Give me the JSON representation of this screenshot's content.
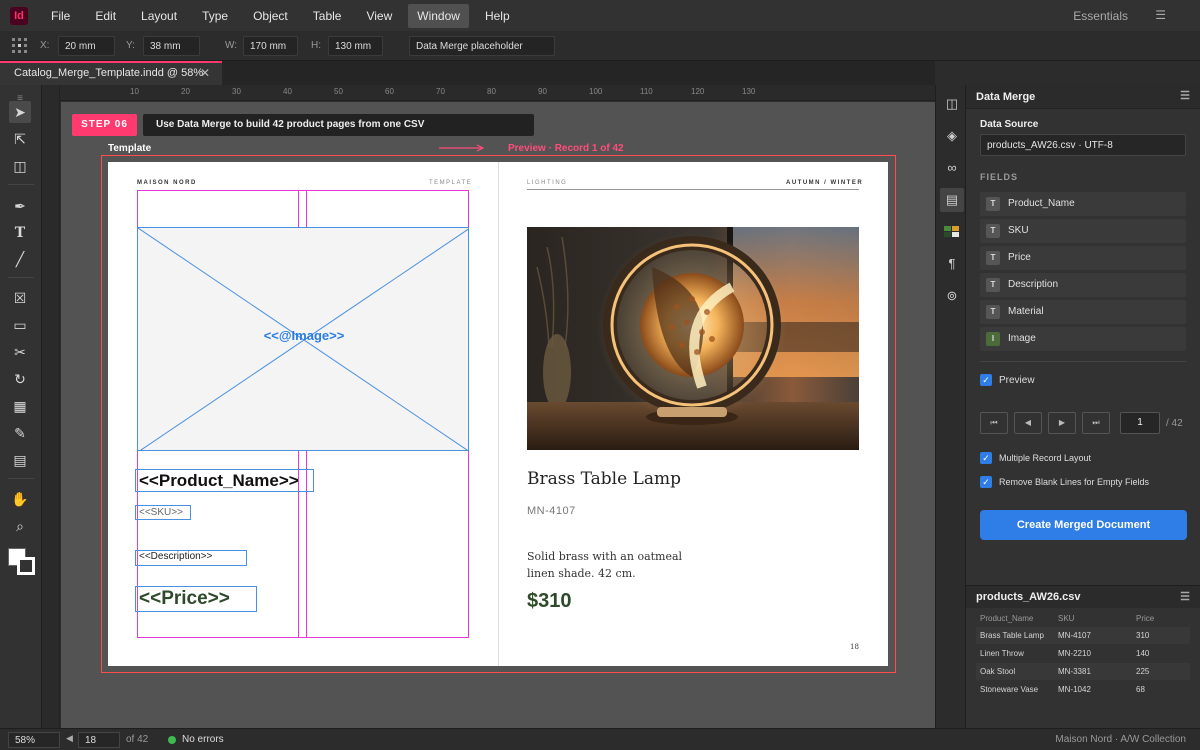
{
  "menubar": {
    "app_icon": "Id",
    "items": [
      "File",
      "Edit",
      "Layout",
      "Type",
      "Object",
      "Table",
      "View",
      "Window",
      "Help"
    ],
    "active_item": "Window",
    "workspace": "Essentials"
  },
  "controlbar": {
    "x_label": "X:",
    "x_value": "20 mm",
    "y_label": "Y:",
    "y_value": "38 mm",
    "w_label": "W:",
    "w_value": "170 mm",
    "h_label": "H:",
    "h_value": "130 mm",
    "object_name": "Data Merge placeholder"
  },
  "tab": {
    "title": "Catalog_Merge_Template.indd @ 58%",
    "close": "✕"
  },
  "ruler_labels": [
    "10",
    "20",
    "30",
    "40",
    "50",
    "60",
    "70",
    "80",
    "90",
    "100",
    "110",
    "120",
    "130"
  ],
  "canvas": {
    "step_badge": "STEP 06",
    "step_text": "Use Data Merge to build 42 product pages from one CSV",
    "template_label": "Template",
    "preview_label": "Preview · Record 1 of 42",
    "arrow_color": "#ff4d7c"
  },
  "template_page": {
    "brand": "MAISON NORD",
    "tag": "TEMPLATE",
    "image_placeholder": "<<@Image>>",
    "product_name_placeholder": "<<Product_Name>>",
    "sku_placeholder": "<<SKU>>",
    "description_placeholder": "<<Description>>",
    "price_placeholder": "<<Price>>"
  },
  "preview_page": {
    "section": "LIGHTING",
    "season": "AUTUMN / WINTER",
    "product_name": "Brass Table Lamp",
    "sku": "MN-4107",
    "description_line1": "Solid brass with an oatmeal",
    "description_line2": "linen shade. 42 cm.",
    "price": "$310",
    "page_number": "18"
  },
  "panel": {
    "title": "Data Merge",
    "data_source_label": "Data Source",
    "data_source_value": "products_AW26.csv · UTF-8",
    "fields_label": "FIELDS",
    "fields": [
      {
        "type": "T",
        "name": "Product_Name"
      },
      {
        "type": "T",
        "name": "SKU"
      },
      {
        "type": "T",
        "name": "Price"
      },
      {
        "type": "T",
        "name": "Description"
      },
      {
        "type": "T",
        "name": "Material"
      },
      {
        "type": "I",
        "name": "Image"
      }
    ],
    "preview_label": "Preview",
    "nav_buttons": [
      "⏮",
      "◀",
      "▶",
      "⏭"
    ],
    "record_value": "1",
    "record_total": "/ 42",
    "multiple_record_label": "Multiple Record Layout",
    "remove_blank_label": "Remove Blank Lines for Empty Fields",
    "create_button": "Create Merged Document"
  },
  "csv_panel": {
    "title": "products_AW26.csv",
    "columns": [
      "Product_Name",
      "SKU",
      "Price"
    ],
    "rows": [
      [
        "Brass Table Lamp",
        "MN-4107",
        "310"
      ],
      [
        "Linen Throw",
        "MN-2210",
        "140"
      ],
      [
        "Oak Stool",
        "MN-3381",
        "225"
      ],
      [
        "Stoneware Vase",
        "MN-1042",
        "68"
      ]
    ]
  },
  "statusbar": {
    "zoom": "58%",
    "page": "18",
    "page_total": "of 42",
    "status": "No errors",
    "status_color": "#3fb950",
    "footer": "Maison Nord · A/W Collection"
  }
}
